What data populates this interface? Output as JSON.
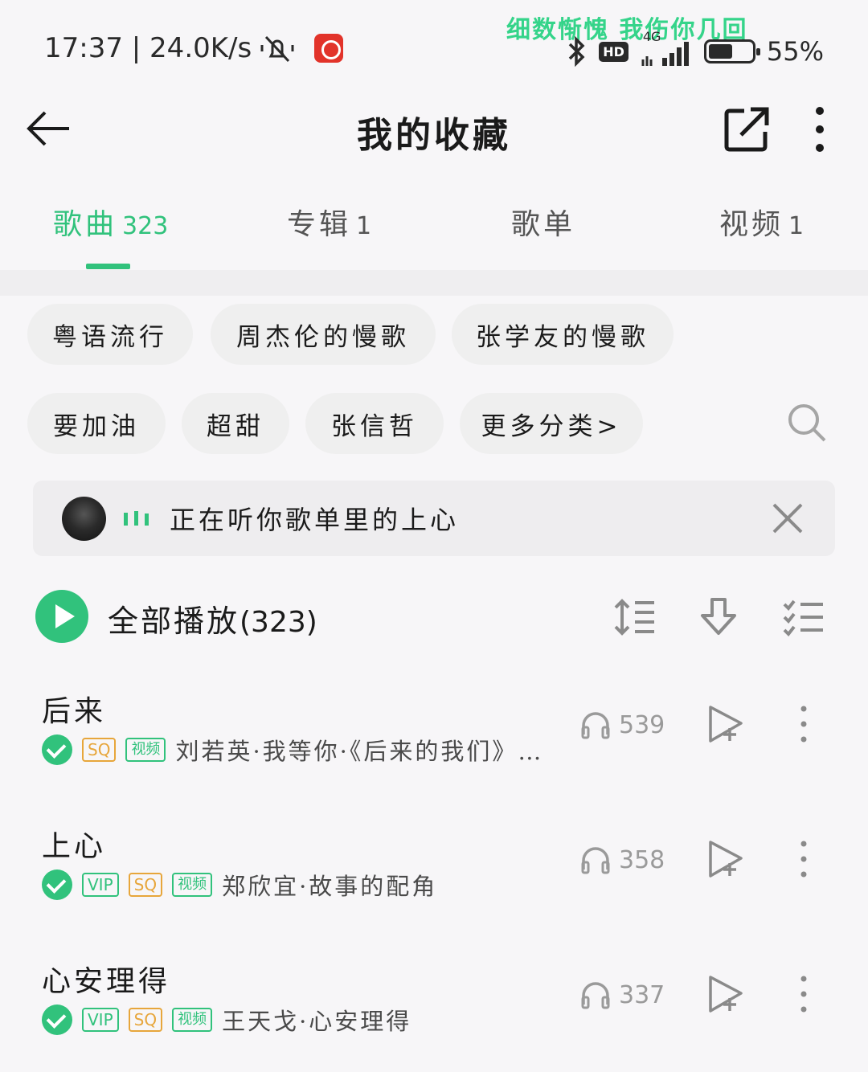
{
  "status_bar": {
    "time_speed": "17:37 | 24.0K/s",
    "lyric": "细数惭愧 我伤你几回",
    "hd": "HD",
    "network": "4G",
    "battery": "55%",
    "battery_level": 0.55
  },
  "header": {
    "title": "我的收藏"
  },
  "tabs": [
    {
      "label": "歌曲",
      "count": "323",
      "active": true
    },
    {
      "label": "专辑",
      "count": "1",
      "active": false
    },
    {
      "label": "歌单",
      "count": "",
      "active": false
    },
    {
      "label": "视频",
      "count": "1",
      "active": false
    }
  ],
  "categories": [
    "粤语流行",
    "周杰伦的慢歌",
    "张学友的慢歌",
    "要加油",
    "超甜",
    "张信哲",
    "更多分类>"
  ],
  "now_playing": {
    "text": "正在听你歌单里的上心"
  },
  "play_all": {
    "label": "全部播放",
    "count": "(323)"
  },
  "songs": [
    {
      "title": "后来",
      "tags": [
        "SQ",
        "视频"
      ],
      "meta": "刘若英·我等你·《后来的我们》电影原声…",
      "plays": "539"
    },
    {
      "title": "上心",
      "tags": [
        "VIP",
        "SQ",
        "视频"
      ],
      "meta": "郑欣宜·故事的配角",
      "plays": "358"
    },
    {
      "title": "心安理得",
      "tags": [
        "VIP",
        "SQ",
        "视频"
      ],
      "meta": "王天戈·心安理得",
      "plays": "337"
    }
  ],
  "colors": {
    "accent": "#31c27c",
    "sq_tag": "#e7a63b",
    "background": "#f7f6f8"
  },
  "icons": [
    "back-arrow-icon",
    "share-icon",
    "more-vertical-icon",
    "search-icon",
    "close-icon",
    "sort-icon",
    "download-icon",
    "multi-select-icon",
    "headphones-icon",
    "add-to-playlist-icon"
  ]
}
